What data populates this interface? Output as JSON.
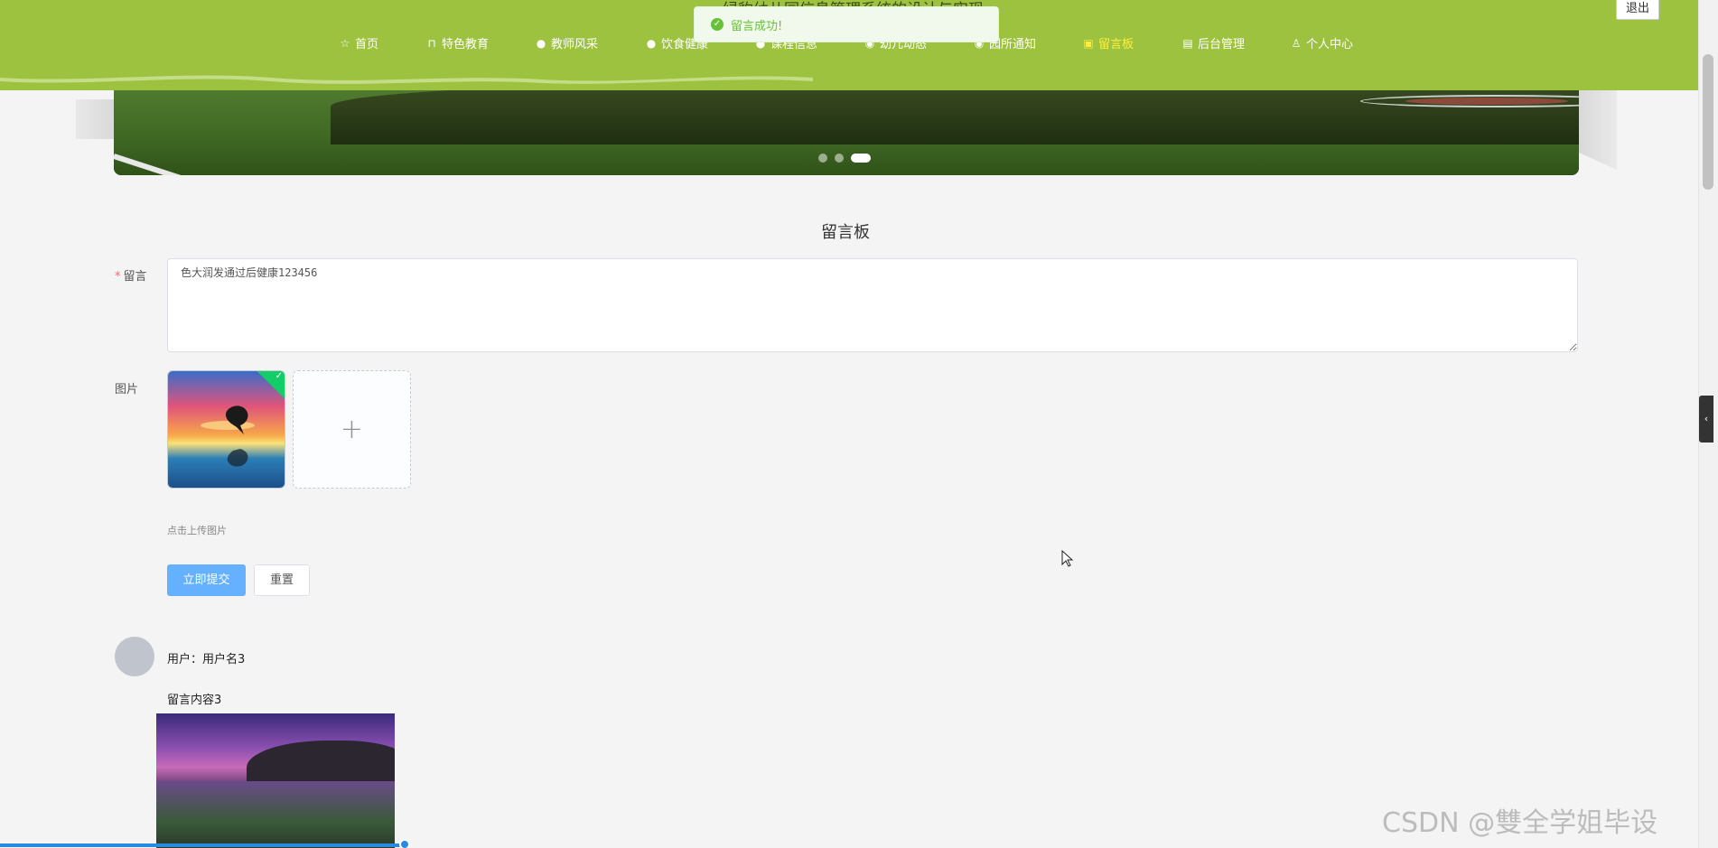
{
  "header": {
    "site_title": "绿豹幼儿园信息管理系统的设计与实现",
    "logout_label": "退出",
    "nav": [
      {
        "label": "首页",
        "icon": "star-icon",
        "active": false
      },
      {
        "label": "特色教育",
        "icon": "bag-icon",
        "active": false
      },
      {
        "label": "教师风采",
        "icon": "info-icon",
        "active": false
      },
      {
        "label": "饮食健康",
        "icon": "clock-icon",
        "active": false
      },
      {
        "label": "课程信息",
        "icon": "info-icon",
        "active": false
      },
      {
        "label": "幼儿动态",
        "icon": "eye-icon",
        "active": false
      },
      {
        "label": "园所通知",
        "icon": "eye-icon",
        "active": false
      },
      {
        "label": "留言板",
        "icon": "camera-icon",
        "active": true
      },
      {
        "label": "后台管理",
        "icon": "briefcase-icon",
        "active": false
      },
      {
        "label": "个人中心",
        "icon": "user-icon",
        "active": false
      }
    ]
  },
  "toast": {
    "message": "留言成功!",
    "color": "#67c23a"
  },
  "banner": {
    "slides": 3,
    "active_slide": 3
  },
  "form": {
    "title": "留言板",
    "message_label": "留言",
    "message_value": "色大润发通过后健康123456",
    "image_label": "图片",
    "upload_hint": "点击上传图片",
    "submit_label": "立即提交",
    "reset_label": "重置"
  },
  "comment": {
    "user_line": "用户：用户名3",
    "content": "留言内容3"
  },
  "watermark": "CSDN @雙全学姐毕设",
  "colors": {
    "header": "#9dc23f",
    "accent": "#66b1ff",
    "active_nav": "#ffef3a"
  }
}
